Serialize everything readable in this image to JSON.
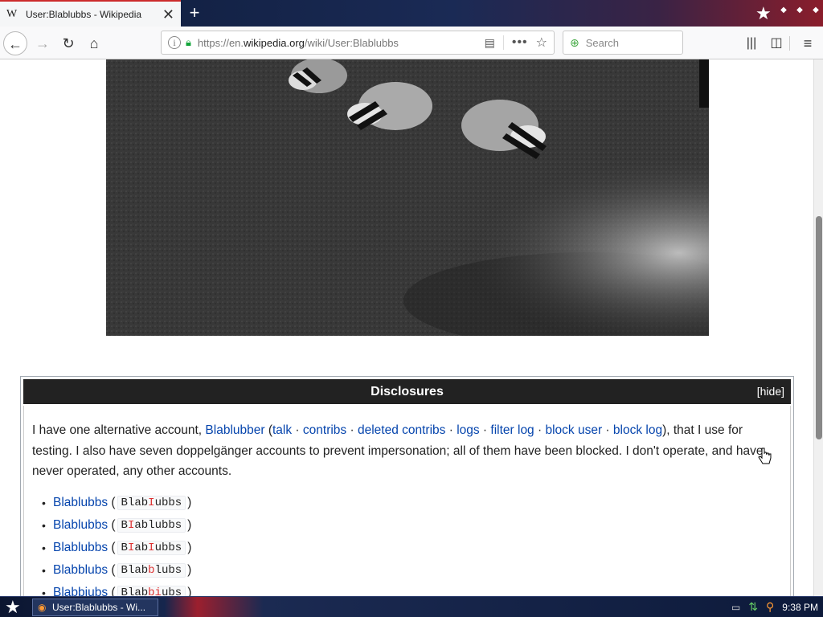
{
  "browser": {
    "tab_title": "User:Blablubbs - Wikipedia",
    "tab_logo": "W",
    "url_prefix": "https://en.",
    "url_domain": "wikipedia.org",
    "url_path": "/wiki/User:Blablubbs",
    "search_placeholder": "Search"
  },
  "page": {
    "image_alt": "Three badgers foraging on grass",
    "disclosures": {
      "title": "Disclosures",
      "hide_label": "[hide]",
      "para_start": "I have one alternative account, ",
      "alt_account": "Blablubber",
      "paren_open": " (",
      "links": [
        "talk",
        "contribs",
        "deleted contribs",
        "logs",
        "filter log",
        "block user",
        "block log"
      ],
      "separator": " · ",
      "para_end": "), that I use for testing. I also have seven doppelgänger accounts to prevent impersonation; all of them have been blocked. I don't operate, and have never operated, any other accounts.",
      "accounts": [
        {
          "name": "Blablubbs",
          "code_parts": [
            "Blab",
            "I",
            "ubbs"
          ]
        },
        {
          "name": "Blablubbs",
          "code_parts": [
            "B",
            "I",
            "ablubbs"
          ]
        },
        {
          "name": "Blablubbs",
          "code_parts": [
            "B",
            "I",
            "ab",
            "I",
            "ubbs"
          ]
        },
        {
          "name": "Blabblubs",
          "code_parts": [
            "Blab",
            "b",
            "lubs"
          ]
        },
        {
          "name": "Blabbiubs",
          "code_parts": [
            "Blab",
            "bi",
            "ubs"
          ]
        }
      ]
    }
  },
  "taskbar": {
    "task_label": "User:Blablubbs - Wi...",
    "clock": "9:38 PM"
  }
}
